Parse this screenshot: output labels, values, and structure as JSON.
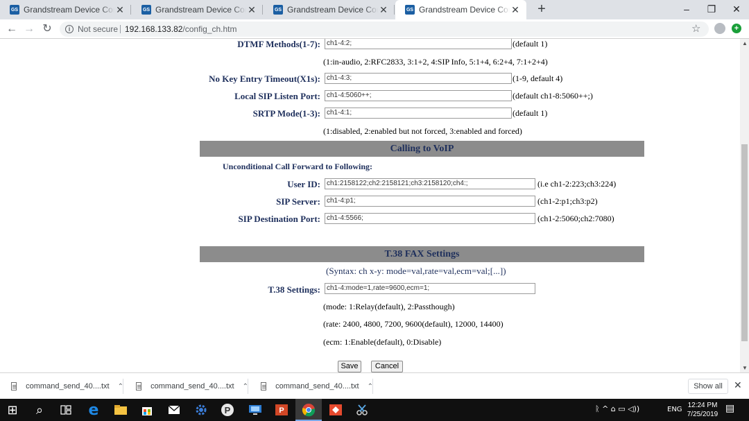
{
  "browser": {
    "tabs": [
      {
        "favicon": "GS",
        "title": "Grandstream Device Configuration",
        "close": "✕"
      },
      {
        "favicon": "GS",
        "title": "Grandstream Device Configuration",
        "close": "✕"
      },
      {
        "favicon": "GS",
        "title": "Grandstream Device Configuration",
        "close": "✕"
      },
      {
        "favicon": "GS",
        "title": "Grandstream Device Configuration",
        "close": "✕"
      }
    ],
    "new_tab": "+",
    "window": {
      "minimize": "–",
      "restore": "❐",
      "close": "✕"
    },
    "nav": {
      "back": "←",
      "forward": "→",
      "reload": "↻"
    },
    "security_label": "Not secure",
    "url_host": "192.168.133.82",
    "url_path": "/config_ch.htm",
    "star": "☆"
  },
  "page": {
    "dtmf": {
      "label": "DTMF Methods(1-7):",
      "value": "ch1-4:2;",
      "hint": "(default 1)"
    },
    "dtmf_note": "(1:in-audio, 2:RFC2833, 3:1+2, 4:SIP Info, 5:1+4, 6:2+4, 7:1+2+4)",
    "no_key": {
      "label": "No Key Entry Timeout(X1s):",
      "value": "ch1-4:3;",
      "hint": "(1-9, default 4)"
    },
    "local_sip": {
      "label": "Local SIP Listen Port:",
      "value": "ch1-4:5060++;",
      "hint": "(default ch1-8:5060++;)"
    },
    "srtp": {
      "label": "SRTP Mode(1-3):",
      "value": "ch1-4:1;",
      "hint": "(default 1)"
    },
    "srtp_note": "(1:disabled, 2:enabled but not forced, 3:enabled and forced)",
    "calling_voip": {
      "title": "Calling to VoIP",
      "subhead": "Unconditional Call Forward to Following:",
      "user_id": {
        "label": "User ID:",
        "value": "ch1:2158122;ch2:2158121;ch3:2158120;ch4:;",
        "hint": "(i.e ch1-2:223;ch3:224)"
      },
      "sip_server": {
        "label": "SIP Server:",
        "value": "ch1-4:p1;",
        "hint": "(ch1-2:p1;ch3:p2)"
      },
      "sip_dest_port": {
        "label": "SIP Destination Port:",
        "value": "ch1-4:5566;",
        "hint": "(ch1-2:5060;ch2:7080)"
      }
    },
    "t38": {
      "title": "T.38 FAX Settings",
      "syntax": "(Syntax: ch x-y: mode=val,rate=val,ecm=val;[...])",
      "settings": {
        "label": "T.38 Settings:",
        "value": "ch1-4:mode=1,rate=9600,ecm=1;"
      },
      "mode_note": "(mode: 1:Relay(default), 2:Passthough)",
      "rate_note": "(rate: 2400, 4800, 7200, 9600(default), 12000, 14400)",
      "ecm_note": "(ecm: 1:Enable(default), 0:Disable)"
    },
    "save": "Save",
    "cancel": "Cancel"
  },
  "downloads": {
    "items": [
      {
        "name": "command_send_40....txt",
        "chevron": "⌃"
      },
      {
        "name": "command_send_40....txt",
        "chevron": "⌃"
      },
      {
        "name": "command_send_40....txt",
        "chevron": "⌃"
      }
    ],
    "show_all": "Show all",
    "close": "✕"
  },
  "taskbar": {
    "start": "⊞",
    "search": "⌕",
    "clock_time": "12:24 PM",
    "clock_date": "7/25/2019",
    "language": "ENG",
    "tray_icons": "ᚱ  ^  ⌂ ▭ ◁))",
    "notifications": "▤"
  },
  "colors": {
    "label_blue": "#1e2f5c",
    "section_gray": "#8c8c8c",
    "favicon_blue": "#1b5fa3"
  }
}
